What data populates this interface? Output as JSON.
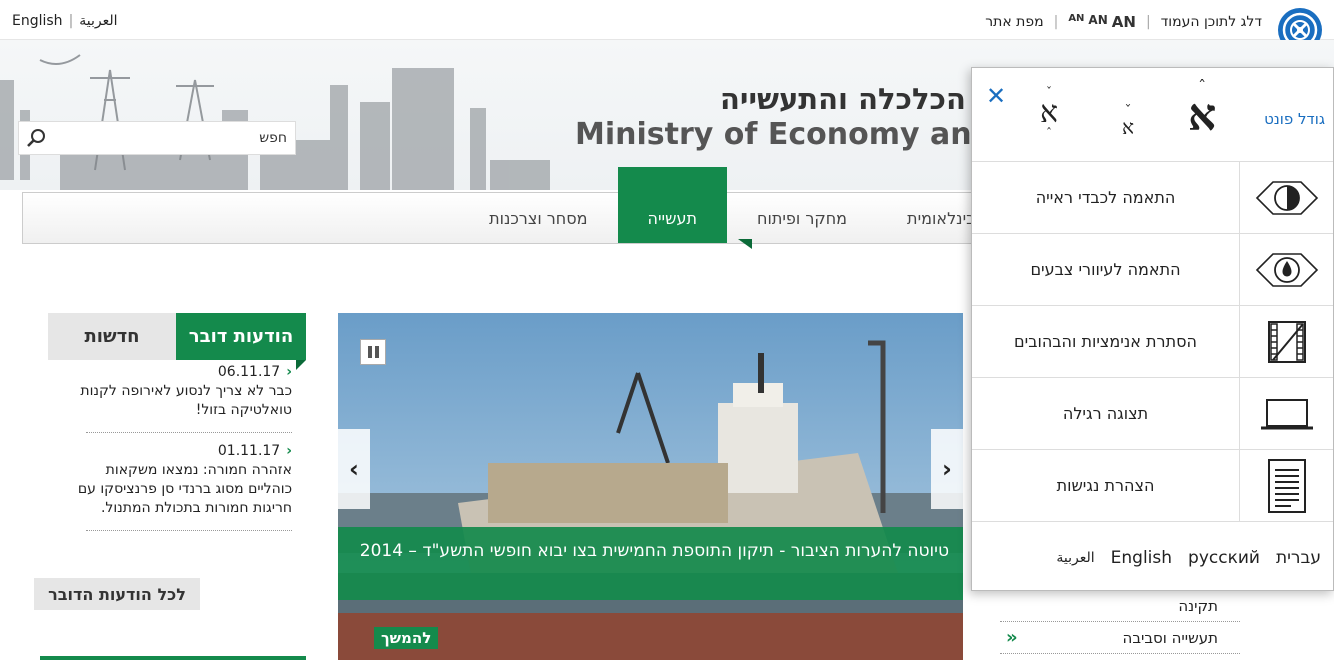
{
  "topbar": {
    "lang_english": "English",
    "lang_arabic": "العربية",
    "skip_link": "דלג לתוכן העמוד",
    "font_sizes": [
      "AN",
      "AN",
      "AN"
    ],
    "sitemap": "מפת אתר"
  },
  "header": {
    "ministry_hebrew": "הכלכלה והתעשייה",
    "ministry_english": "Ministry of Economy and In",
    "search_placeholder": "חפש"
  },
  "nav": {
    "items": [
      {
        "label": "ת בינלאומית"
      },
      {
        "label": "מחקר ופיתוח"
      },
      {
        "label": "תעשייה"
      },
      {
        "label": "מסחר וצרכנות"
      }
    ]
  },
  "news": {
    "tab_press": "הודעות דובר",
    "tab_news": "חדשות",
    "items": [
      {
        "date": "06.11.17",
        "text": "כבר לא צריך לנסוע לאירופה לקנות טואלטיקה בזול!"
      },
      {
        "date": "01.11.17",
        "text": "אזהרה חמורה: נמצאו משקאות כוהליים מסוג ברנדי סן פרנציסקו עם חריגות חמורות בתכולת המתנול."
      }
    ],
    "all_link": "לכל הודעות הדובר"
  },
  "carousel": {
    "caption": "טיוטה להערות הציבור - תיקון התוספת החמישית בצו יבוא חופשי התשע\"ד – 2014",
    "more": "להמשך",
    "prev": "‹",
    "next": "›"
  },
  "side_list": {
    "items": [
      "תקינה",
      "תעשייה וסביבה"
    ]
  },
  "accessibility": {
    "font_size_label": "גודל פונט",
    "options": [
      {
        "label": "התאמה לכבדי ראייה",
        "icon": "contrast-icon"
      },
      {
        "label": "התאמה לעיוורי צבעים",
        "icon": "eye-drop-icon"
      },
      {
        "label": "הסתרת אנימציות והבהובים",
        "icon": "film-strike-icon"
      },
      {
        "label": "תצוגה רגילה",
        "icon": "laptop-icon"
      },
      {
        "label": "הצהרת נגישות",
        "icon": "document-icon"
      }
    ],
    "languages": [
      "עברית",
      "русский",
      "English",
      "العربية"
    ]
  },
  "colors": {
    "green": "#148a4c",
    "blue": "#1a6ec0"
  }
}
